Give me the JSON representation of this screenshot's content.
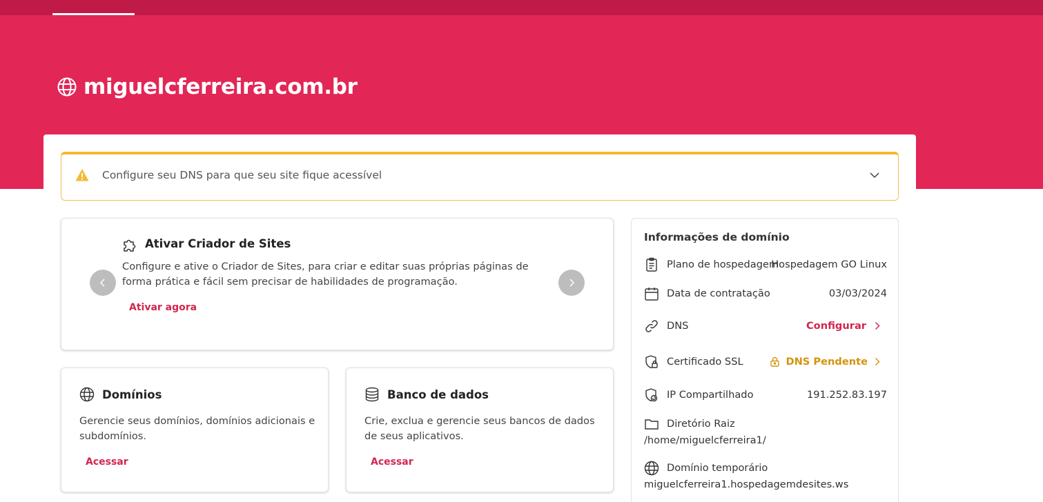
{
  "hero": {
    "domain_title": "miguelcferreira.com.br",
    "bg_color": "#e22656",
    "nav_color": "#bf1a48"
  },
  "alert": {
    "message": "Configure seu DNS para que seu site fique acessível",
    "icon": "warning-icon",
    "border_color": "#f3b931"
  },
  "carousel": {
    "title": "Ativar Criador de Sites",
    "description": "Configure e ative o Criador de Sites, para criar e editar suas próprias páginas de forma prática e fácil sem precisar de habilidades de programação.",
    "action": "Ativar agora",
    "icon": "puzzle-icon"
  },
  "cards": {
    "domains": {
      "title": "Domínios",
      "description": "Gerencie seus domínios, domínios adicionais e subdomínios.",
      "action": "Acessar",
      "icon": "globe-icon"
    },
    "database": {
      "title": "Banco de dados",
      "description": "Crie, exclua e gerencie seus bancos de dados de seus aplicativos.",
      "action": "Acessar",
      "icon": "database-icon"
    }
  },
  "info": {
    "title": "Informações de domínio",
    "plan_label": "Plano de hospedagem",
    "plan_value": "Hospedagem GO Linux",
    "date_label": "Data de contratação",
    "date_value": "03/03/2024",
    "dns_label": "DNS",
    "dns_action": "Configurar",
    "ssl_label": "Certificado SSL",
    "ssl_action": "DNS Pendente",
    "ip_label": "IP Compartilhado",
    "ip_value": "191.252.83.197",
    "root_label": "Diretório Raiz",
    "root_value": "/home/miguelcferreira1/",
    "temp_label": "Domínio temporário",
    "temp_value": "miguelcferreira1.hospedagemdesites.ws",
    "accent_color": "#d1264f",
    "pending_color": "#d4930c"
  }
}
